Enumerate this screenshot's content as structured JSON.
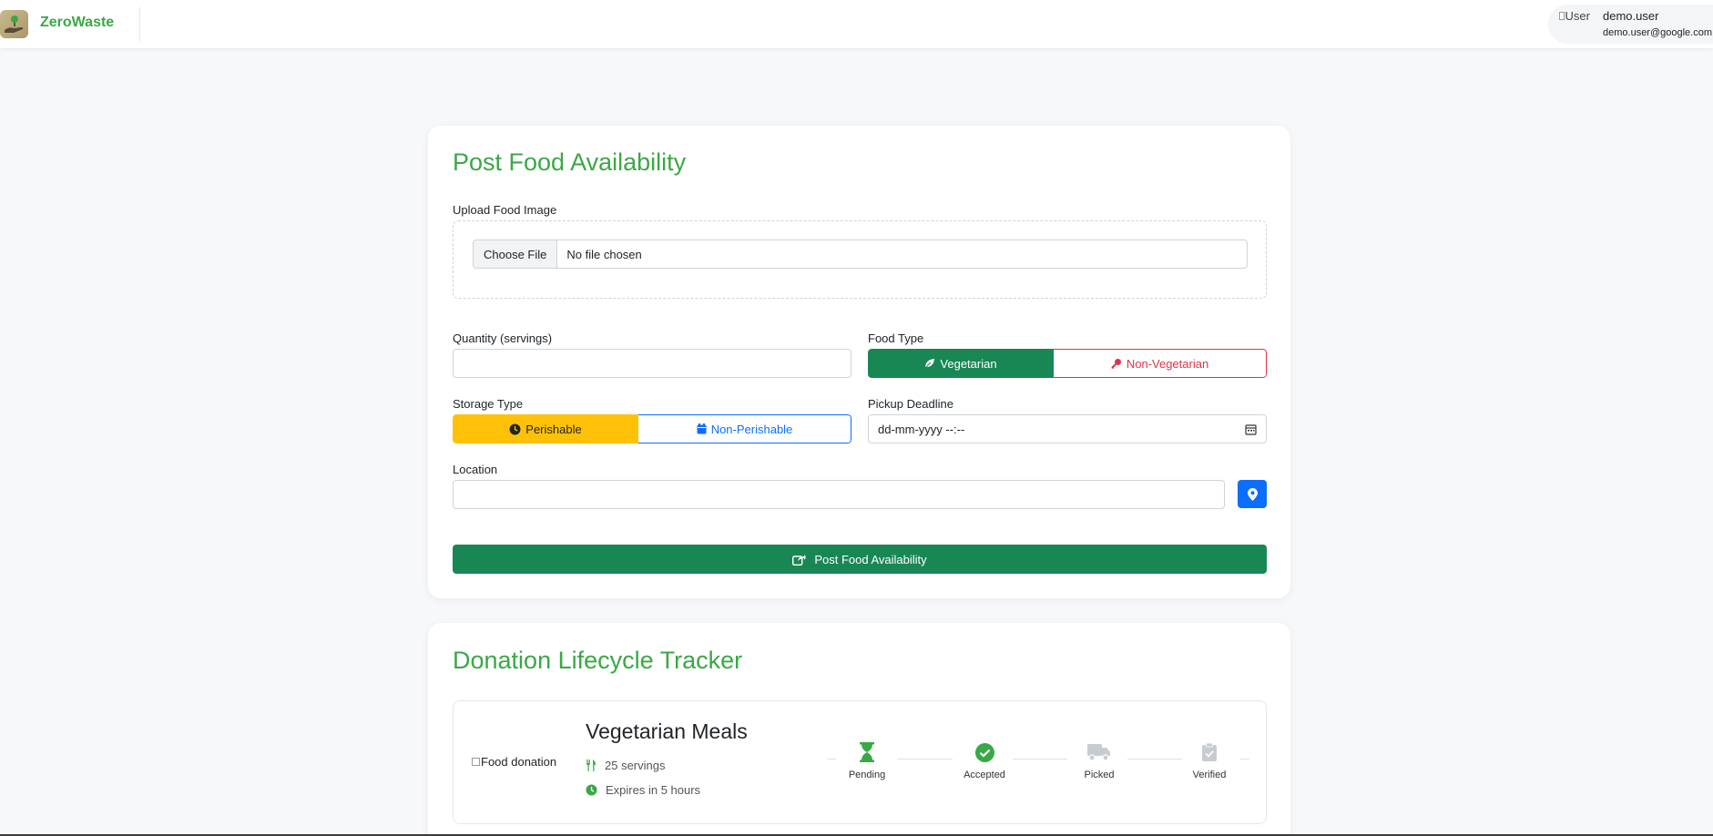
{
  "app": {
    "name": "ZeroWaste",
    "user": {
      "avatar_alt": "User",
      "name": "demo.user",
      "email": "demo.user@google.com"
    }
  },
  "post_form": {
    "title": "Post Food Availability",
    "upload_label": "Upload Food Image",
    "file_button": "Choose File",
    "file_status": "No file chosen",
    "quantity_label": "Quantity (servings)",
    "quantity_value": "",
    "food_type_label": "Food Type",
    "food_type_options": [
      "Vegetarian",
      "Non-Vegetarian"
    ],
    "food_type_selected": "Vegetarian",
    "storage_label": "Storage Type",
    "storage_options": [
      "Perishable",
      "Non-Perishable"
    ],
    "storage_selected": "Perishable",
    "deadline_label": "Pickup Deadline",
    "deadline_placeholder": "dd-mm-yyyy --:--",
    "location_label": "Location",
    "location_value": "",
    "submit_label": "Post Food Availability"
  },
  "tracker": {
    "title": "Donation Lifecycle Tracker",
    "donations": [
      {
        "image_alt": "Food donation",
        "name": "Vegetarian Meals",
        "servings": "25 servings",
        "expiry": "Expires in 5 hours",
        "steps": [
          {
            "label": "Pending",
            "state": "active",
            "icon": "hourglass-icon"
          },
          {
            "label": "Accepted",
            "state": "done",
            "icon": "check-circle-icon"
          },
          {
            "label": "Picked",
            "state": "inactive",
            "icon": "truck-icon"
          },
          {
            "label": "Verified",
            "state": "inactive",
            "icon": "clipboard-check-icon"
          }
        ]
      }
    ]
  },
  "colors": {
    "brand_green": "#3aa845",
    "success": "#198754",
    "danger": "#dc3545",
    "warning": "#ffc107",
    "primary": "#0d6efd",
    "inactive": "#c8ccd0"
  }
}
